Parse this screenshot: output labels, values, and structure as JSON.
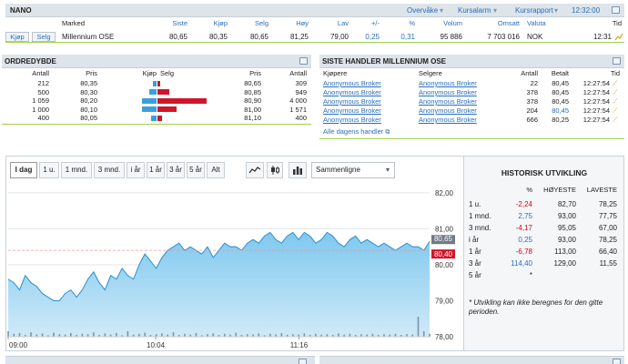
{
  "nano": {
    "title": "NANO",
    "links": [
      "Overvåke",
      "Kursalarm",
      "Kursrapport"
    ],
    "time": "12:32:00",
    "headers": [
      "Marked",
      "Siste",
      "Kjøp",
      "Selg",
      "Høy",
      "Lav",
      "+/-",
      "%",
      "Volum",
      "Omsatt",
      "Valuta",
      "Tid"
    ],
    "buy_label": "Kjøp",
    "sell_label": "Selg",
    "row": {
      "marked": "Millennium OSE",
      "siste": "80,65",
      "kjop": "80,35",
      "selg": "80,65",
      "hoy": "81,25",
      "lav": "79,00",
      "change": "0,25",
      "pct": "0,31",
      "volum": "95 886",
      "omsatt": "7 703 016",
      "valuta": "NOK",
      "tid": "12:31"
    }
  },
  "orderbook": {
    "title": "ORDREDYBDE",
    "headers": [
      "Antall",
      "Pris",
      "Kjøp",
      "Selg",
      "Pris",
      "Antall"
    ],
    "rows": [
      {
        "bid_qty": "212",
        "bid_price": "80,35",
        "bid_depth": 0.06,
        "ask_depth": 0.05,
        "ask_price": "80,65",
        "ask_qty": "309"
      },
      {
        "bid_qty": "500",
        "bid_price": "80,30",
        "bid_depth": 0.13,
        "ask_depth": 0.21,
        "ask_price": "80,85",
        "ask_qty": "949"
      },
      {
        "bid_qty": "1 059",
        "bid_price": "80,20",
        "bid_depth": 0.27,
        "ask_depth": 0.9,
        "ask_price": "80,90",
        "ask_qty": "4 000"
      },
      {
        "bid_qty": "1 000",
        "bid_price": "80,10",
        "bid_depth": 0.26,
        "ask_depth": 0.35,
        "ask_price": "81,00",
        "ask_qty": "1 571"
      },
      {
        "bid_qty": "400",
        "bid_price": "80,05",
        "bid_depth": 0.1,
        "ask_depth": 0.09,
        "ask_price": "81,10",
        "ask_qty": "400"
      }
    ]
  },
  "trades": {
    "title": "SISTE HANDLER MILLENNIUM OSE",
    "headers": [
      "Kjøpere",
      "Selgere",
      "Antall",
      "Betalt",
      "Tid"
    ],
    "rows": [
      {
        "buyer": "Anonymous Broker",
        "seller": "Anonymous Broker",
        "qty": "22",
        "price": "80,45",
        "time": "12:27:54",
        "hl": false
      },
      {
        "buyer": "Anonymous Broker",
        "seller": "Anonymous Broker",
        "qty": "378",
        "price": "80,45",
        "time": "12:27:54",
        "hl": false
      },
      {
        "buyer": "Anonymous Broker",
        "seller": "Anonymous Broker",
        "qty": "378",
        "price": "80,45",
        "time": "12:27:54",
        "hl": false
      },
      {
        "buyer": "Anonymous Broker",
        "seller": "Anonymous Broker",
        "qty": "204",
        "price": "80,45",
        "time": "12:27:54",
        "hl": true
      },
      {
        "buyer": "Anonymous Broker",
        "seller": "Anonymous Broker",
        "qty": "666",
        "price": "80,25",
        "time": "12:27:54",
        "hl": false
      }
    ],
    "all_link": "Alle dagens handler"
  },
  "chart_tabs": [
    "I dag",
    "1 u.",
    "1 mnd.",
    "3 mnd.",
    "i år",
    "1 år",
    "3 år",
    "5 år",
    "Alt"
  ],
  "compare_label": "Sammenligne",
  "chart_data": {
    "type": "area",
    "x_ticks": [
      "09:00",
      "10:04",
      "11:16"
    ],
    "y_ticks": [
      "82,00",
      "81,00",
      "80,00",
      "79,00",
      "78,00"
    ],
    "ylim": [
      78.0,
      82.25
    ],
    "last_label": "80,65",
    "ref_label": "80,40",
    "ref_value": 80.4,
    "values": [
      79.6,
      79.5,
      79.3,
      79.7,
      79.5,
      79.4,
      79.2,
      79.1,
      79.0,
      79.0,
      79.2,
      79.3,
      79.1,
      79.3,
      79.6,
      79.8,
      79.5,
      79.3,
      79.7,
      79.6,
      79.9,
      79.7,
      79.6,
      80.0,
      80.3,
      80.1,
      79.9,
      80.2,
      80.4,
      80.5,
      80.6,
      80.4,
      80.5,
      80.4,
      80.3,
      80.5,
      80.2,
      80.4,
      80.6,
      80.5,
      80.5,
      80.4,
      80.6,
      80.7,
      80.6,
      80.8,
      80.9,
      80.7,
      80.6,
      80.8,
      80.9,
      80.7,
      80.9,
      80.8,
      80.6,
      80.7,
      80.9,
      80.8,
      80.6,
      80.5,
      80.7,
      80.8,
      80.6,
      80.7,
      80.6,
      80.5,
      80.6,
      80.5,
      80.4,
      80.5,
      80.6,
      80.5,
      80.5,
      80.4,
      80.65
    ],
    "volumes": [
      0.15,
      0.08,
      0.1,
      0.05,
      0.12,
      0.06,
      0.09,
      0.04,
      0.11,
      0.07,
      0.06,
      0.1,
      0.05,
      0.08,
      0.07,
      0.12,
      0.05,
      0.09,
      0.06,
      0.1,
      0.04,
      0.15,
      0.06,
      0.08,
      0.11,
      0.05,
      0.07,
      0.09,
      0.06,
      0.12,
      0.05,
      0.08,
      0.06,
      0.1,
      0.04,
      0.07,
      0.09,
      0.05,
      0.08,
      0.06,
      0.11,
      0.05,
      0.07,
      0.06,
      0.09,
      0.04,
      0.08,
      0.06,
      0.1,
      0.05,
      0.07,
      0.06,
      0.09,
      0.05,
      0.08,
      0.06,
      0.07,
      0.05,
      0.09,
      0.06,
      0.08,
      0.05,
      0.07,
      0.06,
      0.08,
      0.05,
      0.07,
      0.06,
      0.08,
      0.05,
      0.07,
      0.06,
      0.55,
      0.15,
      0.08
    ]
  },
  "history": {
    "title": "HISTORISK UTVIKLING",
    "headers": [
      "%",
      "HØYESTE",
      "LAVESTE"
    ],
    "rows": [
      {
        "period": "1 u.",
        "pct": "-2,24",
        "high": "82,70",
        "low": "78,25",
        "neg": true
      },
      {
        "period": "1 mnd.",
        "pct": "2,75",
        "high": "93,00",
        "low": "77,75",
        "neg": false
      },
      {
        "period": "3 mnd.",
        "pct": "-4,17",
        "high": "95,05",
        "low": "67,00",
        "neg": true
      },
      {
        "period": "i år",
        "pct": "0,25",
        "high": "93,00",
        "low": "78,25",
        "neg": false
      },
      {
        "period": "1 år",
        "pct": "-6,78",
        "high": "113,00",
        "low": "66,40",
        "neg": true
      },
      {
        "period": "3 år",
        "pct": "114,40",
        "high": "129,00",
        "low": "11,55",
        "neg": false
      },
      {
        "period": "5 år",
        "pct": "*",
        "high": "",
        "low": "",
        "neg": false
      }
    ],
    "note": "* Utvikling kan ikke beregnes for den gitte perioden."
  },
  "colors": {
    "accent": "#2a6ebb",
    "negative": "#d0021b",
    "bid": "#3aa0dd",
    "ask": "#d0152a",
    "green": "#9fd04d"
  }
}
